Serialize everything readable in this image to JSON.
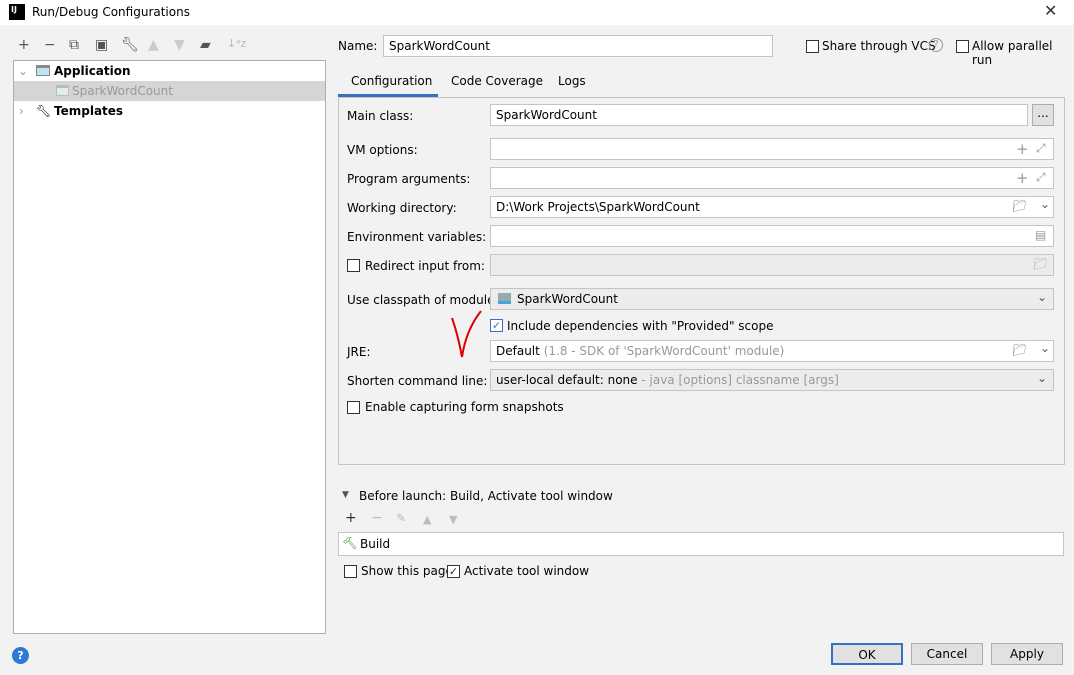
{
  "window": {
    "title": "Run/Debug Configurations",
    "logo": "IJ"
  },
  "toolbar": {
    "icons": [
      "plus-icon",
      "minus-icon",
      "copy-icon",
      "save-icon",
      "wrench-icon",
      "arrow-up-icon",
      "arrow-down-icon",
      "new-folder-icon",
      "sort-az-icon"
    ]
  },
  "tree": {
    "application": "Application",
    "child": "SparkWordCount",
    "templates": "Templates"
  },
  "header": {
    "name_label": "Name:",
    "name_value": "SparkWordCount",
    "share_vcs": "Share through VCS",
    "allow_parallel": "Allow parallel run"
  },
  "tabs": [
    {
      "label": "Configuration",
      "active": true
    },
    {
      "label": "Code Coverage"
    },
    {
      "label": "Logs"
    }
  ],
  "form": {
    "main_class_label": "Main class:",
    "main_class": "SparkWordCount",
    "browse": "...",
    "vm_label": "VM options:",
    "vm": "",
    "args_label": "Program arguments:",
    "args": "",
    "wd_label": "Working directory:",
    "wd": "D:\\Work Projects\\SparkWordCount",
    "env_label": "Environment variables:",
    "env": "",
    "redirect_label": "Redirect input from:",
    "redirect_checked": false,
    "classpath_label": "Use classpath of module:",
    "classpath": "SparkWordCount",
    "include_label": "Include dependencies with \"Provided\" scope",
    "include_checked": true,
    "jre_label": "JRE:",
    "jre": "Default",
    "jre_hint": "(1.8 - SDK of 'SparkWordCount' module)",
    "shorten_label": "Shorten command line:",
    "shorten": "user-local default: none",
    "shorten_hint": "- java [options] classname [args]",
    "capture_label": "Enable capturing form snapshots",
    "capture_checked": false
  },
  "before_launch": {
    "title": "Before launch: Build, Activate tool window",
    "items": [
      "Build"
    ],
    "show_page": "Show this page",
    "show_page_checked": false,
    "activate": "Activate tool window",
    "activate_checked": true
  },
  "buttons": {
    "ok": "OK",
    "cancel": "Cancel",
    "apply": "Apply"
  },
  "colors": {
    "accent": "#3573c0",
    "annotation": "#e00000"
  }
}
